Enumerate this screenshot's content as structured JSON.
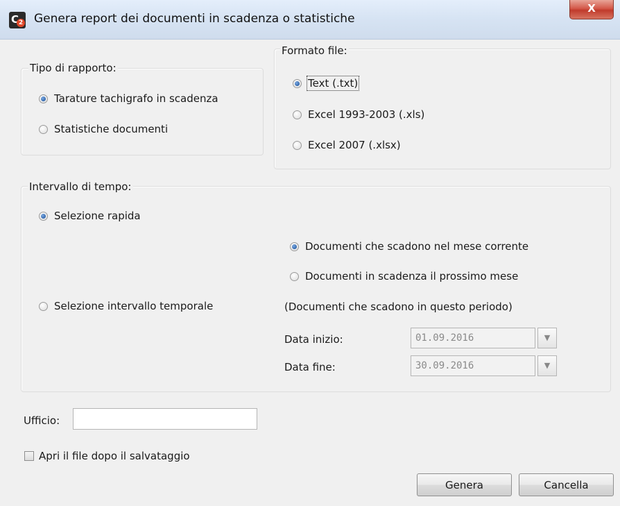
{
  "window": {
    "title": "Genera report dei documenti in scadenza o statistiche",
    "close_glyph": "X"
  },
  "report_type": {
    "legend": "Tipo di rapporto:",
    "options": [
      {
        "label": "Tarature tachigrafo in scadenza",
        "checked": true
      },
      {
        "label": "Statistiche documenti",
        "checked": false
      }
    ]
  },
  "file_format": {
    "legend": "Formato file:",
    "options": [
      {
        "label": "Text (.txt)",
        "checked": true
      },
      {
        "label": "Excel 1993-2003 (.xls)",
        "checked": false
      },
      {
        "label": "Excel 2007 (.xlsx)",
        "checked": false
      }
    ]
  },
  "time_interval": {
    "legend": "Intervallo di tempo:",
    "quick_selection": {
      "label": "Selezione rapida",
      "checked": true
    },
    "quick_options": [
      {
        "label": "Documenti che scadono nel mese corrente",
        "checked": true
      },
      {
        "label": "Documenti in scadenza il prossimo mese",
        "checked": false
      }
    ],
    "range_selection": {
      "label": "Selezione intervallo temporale",
      "checked": false
    },
    "range_note": "(Documenti che scadono in questo periodo)",
    "start_label": "Data inizio:",
    "start_value": "01.09.2016",
    "end_label": "Data fine:",
    "end_value": "30.09.2016"
  },
  "office": {
    "label": "Ufficio:",
    "value": ""
  },
  "open_after_save": {
    "label": "Apri il file dopo il salvataggio",
    "checked": false
  },
  "buttons": {
    "generate": "Genera",
    "cancel": "Cancella"
  }
}
